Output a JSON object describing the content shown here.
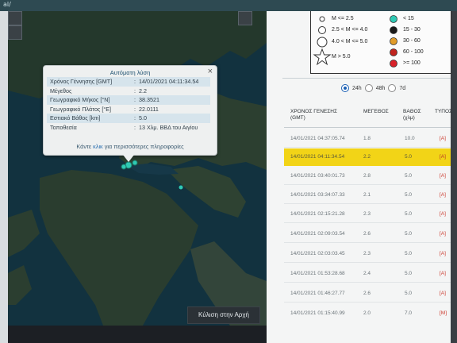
{
  "browser": {
    "title_fragment": "al/"
  },
  "popup": {
    "title": "Αυτόματη λύση",
    "close_glyph": "×",
    "rows": [
      {
        "label": "Χρόνος Γέννησης [GMT]",
        "value": "14/01/2021 04:11:34.54"
      },
      {
        "label": "Μέγεθος",
        "value": "2.2"
      },
      {
        "label": "Γεωγραφικό Μήκος [°N]",
        "value": "38.3521"
      },
      {
        "label": "Γεωγραφικό Πλάτος [°E]",
        "value": "22.0111"
      },
      {
        "label": "Εστιακό Βάθος [km]",
        "value": "5.0"
      },
      {
        "label": "Τοποθεσία",
        "value": "13 Χλμ. ΒΒΔ του Αιγίου"
      }
    ],
    "more_prefix": "Κάντε",
    "more_link": "κλικ",
    "more_suffix": "για περισσότερες πληροφορίες"
  },
  "scroll_top_button": "Κύλιση στην Αρχή",
  "legend": {
    "magnitude": [
      {
        "label": "M <= 2.5"
      },
      {
        "label": "2.5 < M <= 4.0"
      },
      {
        "label": "4.0 < M <= 5.0"
      },
      {
        "label": "M > 5.0"
      }
    ],
    "depth": [
      {
        "label": "< 15",
        "color": "#2fc9b4"
      },
      {
        "label": "15 - 30",
        "color": "#1a1a1a"
      },
      {
        "label": "30 - 60",
        "color": "#e09c2a"
      },
      {
        "label": "60 - 100",
        "color": "#c0241e"
      },
      {
        "label": ">= 100",
        "color": "#d8222a"
      }
    ]
  },
  "filters": {
    "options": [
      "24h",
      "48h",
      "7d"
    ],
    "selected": "24h"
  },
  "table": {
    "headers": {
      "time": "ΧΡΟΝΟΣ ΓΕΝΕΣΗΣ\n(GMT)",
      "mag": "ΜΕΓΕΘΟΣ",
      "depth": "ΒΑΘΟΣ\n(χλμ)",
      "type": "ΤΥΠΟΣ"
    },
    "rows": [
      {
        "time": "14/01/2021 04:37:05.74",
        "mag": "1.8",
        "depth": "10.0",
        "type": "[A]"
      },
      {
        "time": "14/01/2021 04:11:34.54",
        "mag": "2.2",
        "depth": "5.0",
        "type": "[A]",
        "selected": true
      },
      {
        "time": "14/01/2021 03:40:01.73",
        "mag": "2.8",
        "depth": "5.0",
        "type": "[A]"
      },
      {
        "time": "14/01/2021 03:34:07.33",
        "mag": "2.1",
        "depth": "5.0",
        "type": "[A]"
      },
      {
        "time": "14/01/2021 02:15:21.28",
        "mag": "2.3",
        "depth": "5.0",
        "type": "[A]"
      },
      {
        "time": "14/01/2021 02:09:03.54",
        "mag": "2.6",
        "depth": "5.0",
        "type": "[A]"
      },
      {
        "time": "14/01/2021 02:03:03.45",
        "mag": "2.3",
        "depth": "5.0",
        "type": "[A]"
      },
      {
        "time": "14/01/2021 01:53:28.68",
        "mag": "2.4",
        "depth": "5.0",
        "type": "[A]"
      },
      {
        "time": "14/01/2021 01:46:27.77",
        "mag": "2.6",
        "depth": "5.0",
        "type": "[A]"
      },
      {
        "time": "14/01/2021 01:15:40.99",
        "mag": "2.0",
        "depth": "7.0",
        "type": "[M]"
      }
    ]
  }
}
